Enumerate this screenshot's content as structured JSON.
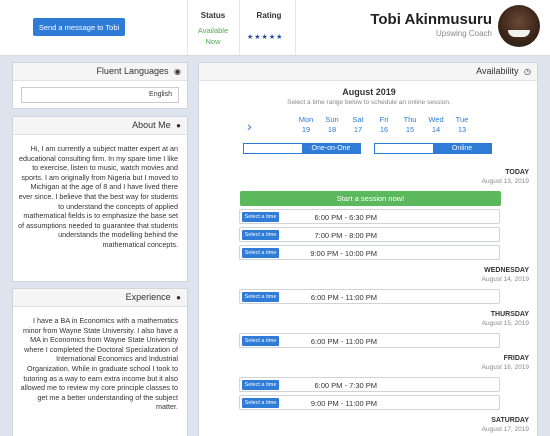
{
  "profile": {
    "name": "Tobi Akinmusuru",
    "role": "Upswing Coach",
    "rating_label": "Rating",
    "stars": "★★★★★",
    "status_label": "Status",
    "status_line1": "Available",
    "status_line2": "Now",
    "message_button": "Send a message to Tobi"
  },
  "languages": {
    "title": "Fluent Languages",
    "items": [
      "English"
    ]
  },
  "about": {
    "title": "About Me",
    "text": "Hi, I am currently a subject matter expert at an educational consulting firm. In my spare time I like to exercise, listen to music, watch movies and sports. I am originally from Nigeria but I moved to Michigan at the age of 8 and I have lived there ever since. I believe that the best way for students to understand the concepts of applied mathematical fields is to emphasize the base set of assumptions needed to guarantee that students understands the modelling behind the mathematical concepts."
  },
  "experience": {
    "title": "Experience",
    "text": "I have a BA in Economics with a mathematics minor from Wayne State University. I also have a MA in Economics from Wayne State University where I completed the Doctoral Specialization of International Economics and Industrial Organization. While in graduate school I took to tutoring as a way to earn extra income but it also allowed me to review my core principle classes to get me a better understanding of the subject matter."
  },
  "availability": {
    "title": "Availability",
    "month": "August 2019",
    "hint": "Select a time range below to schedule an online session.",
    "days": [
      {
        "name": "Tue",
        "num": "13"
      },
      {
        "name": "Wed",
        "num": "14"
      },
      {
        "name": "Thu",
        "num": "15"
      },
      {
        "name": "Fri",
        "num": "16"
      },
      {
        "name": "Sat",
        "num": "17"
      },
      {
        "name": "Sun",
        "num": "18"
      },
      {
        "name": "Mon",
        "num": "19"
      }
    ],
    "mode_online": "Online",
    "mode_oneonone": "One-on-One",
    "start_now": "Start a session now!",
    "select_label": "Select a time",
    "sections": [
      {
        "title": "TODAY",
        "date": "August 13, 2019",
        "slots": [
          "6:00 PM - 6:30 PM",
          "7:00 PM - 8:00 PM",
          "9:00 PM - 10:00 PM"
        ]
      },
      {
        "title": "WEDNESDAY",
        "date": "August 14, 2019",
        "slots": [
          "6:00 PM - 11:00 PM"
        ]
      },
      {
        "title": "THURSDAY",
        "date": "August 15, 2019",
        "slots": [
          "6:00 PM - 11:00 PM"
        ]
      },
      {
        "title": "FRIDAY",
        "date": "August 16, 2019",
        "slots": [
          "6:00 PM - 7:30 PM",
          "9:00 PM - 11:00 PM"
        ]
      },
      {
        "title": "SATURDAY",
        "date": "August 17, 2019",
        "slots": []
      }
    ]
  }
}
